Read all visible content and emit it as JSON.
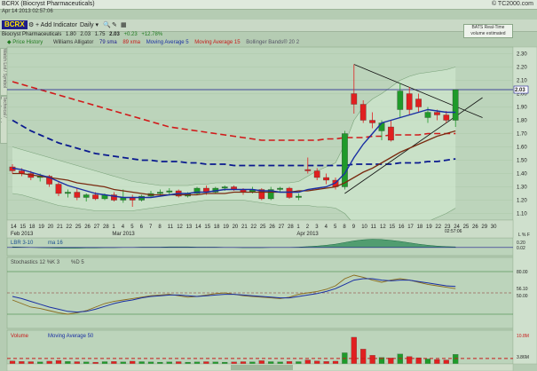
{
  "window": {
    "title": "BCRX (Biocryst Pharmaceuticals)",
    "date": "Apr 14 2013 02:57:06",
    "brand": "© TC2000.com"
  },
  "toolbar": {
    "symbol": "BCRX",
    "add_indicator": "Add Indicator",
    "timeframe": "Daily",
    "bats_label": "BATS Real-Time",
    "bats_sub": "volume estimated"
  },
  "quote": {
    "name": "Biocryst Pharmaceuticals",
    "open": "1.80",
    "high": "2.03",
    "low": "1.75",
    "close": "2.03",
    "change": "+0.23",
    "pct": "+12.78%"
  },
  "legend": [
    "Price History",
    "Williams Alligator",
    "79 sma",
    "89 xma",
    "Moving Average 5",
    "Moving Average 15",
    "Bollinger Bands® 20 2"
  ],
  "side_tabs": [
    "Watch List / Symbol",
    "Technical / Fundamental"
  ],
  "colors": {
    "up": "#1f9a2a",
    "down": "#e02020",
    "ma5": "#1a2fa3",
    "ma15": "#7a2a10",
    "sma79": "#d11a1a",
    "xma89": "#0a1a8f",
    "band": "#7aa37a",
    "lbr": "#2e8b57"
  },
  "chart_data": [
    {
      "type": "candlestick",
      "ylim": [
        1.05,
        2.35
      ],
      "y_ticks": [
        "2.30",
        "2.20",
        "2.10",
        "2.00",
        "1.90",
        "1.80",
        "1.70",
        "1.60",
        "1.50",
        "1.40",
        "1.30",
        "1.20",
        "1.10"
      ],
      "last_price_label": "2.03",
      "x_tick_labels": [
        "14",
        "15",
        "18",
        "19",
        "20",
        "21",
        "22",
        "25",
        "26",
        "27",
        "28",
        "1",
        "4",
        "5",
        "6",
        "7",
        "8",
        "11",
        "12",
        "13",
        "14",
        "15",
        "18",
        "19",
        "20",
        "21",
        "22",
        "25",
        "26",
        "27",
        "28",
        "1",
        "2",
        "3",
        "4",
        "5",
        "8",
        "9",
        "10",
        "11",
        "12",
        "15",
        "16",
        "17",
        "18",
        "19",
        "22",
        "23",
        "24",
        "25",
        "26",
        "29",
        "30"
      ],
      "month_labels": [
        {
          "label": "Feb 2013",
          "at": 0
        },
        {
          "label": "Mar 2013",
          "at": 11
        },
        {
          "label": "Apr 2013",
          "at": 31
        }
      ],
      "corner_label": "02:57:06",
      "axis_options": "L % F",
      "ohlc": [
        [
          1.45,
          1.47,
          1.4,
          1.42
        ],
        [
          1.42,
          1.44,
          1.38,
          1.4
        ],
        [
          1.4,
          1.42,
          1.35,
          1.37
        ],
        [
          1.37,
          1.4,
          1.34,
          1.38
        ],
        [
          1.38,
          1.39,
          1.3,
          1.32
        ],
        [
          1.32,
          1.34,
          1.23,
          1.25
        ],
        [
          1.25,
          1.28,
          1.22,
          1.26
        ],
        [
          1.26,
          1.29,
          1.2,
          1.22
        ],
        [
          1.22,
          1.25,
          1.19,
          1.24
        ],
        [
          1.24,
          1.26,
          1.2,
          1.21
        ],
        [
          1.21,
          1.25,
          1.2,
          1.24
        ],
        [
          1.24,
          1.26,
          1.19,
          1.2
        ],
        [
          1.2,
          1.28,
          1.18,
          1.22
        ],
        [
          1.22,
          1.24,
          1.15,
          1.2
        ],
        [
          1.2,
          1.24,
          1.19,
          1.23
        ],
        [
          1.23,
          1.27,
          1.22,
          1.25
        ],
        [
          1.25,
          1.28,
          1.23,
          1.26
        ],
        [
          1.26,
          1.29,
          1.24,
          1.27
        ],
        [
          1.27,
          1.28,
          1.22,
          1.23
        ],
        [
          1.23,
          1.26,
          1.22,
          1.25
        ],
        [
          1.25,
          1.3,
          1.24,
          1.29
        ],
        [
          1.29,
          1.31,
          1.24,
          1.26
        ],
        [
          1.26,
          1.3,
          1.25,
          1.29
        ],
        [
          1.29,
          1.31,
          1.27,
          1.3
        ],
        [
          1.3,
          1.31,
          1.27,
          1.28
        ],
        [
          1.28,
          1.29,
          1.24,
          1.26
        ],
        [
          1.26,
          1.3,
          1.25,
          1.28
        ],
        [
          1.28,
          1.29,
          1.2,
          1.21
        ],
        [
          1.21,
          1.3,
          1.2,
          1.28
        ],
        [
          1.28,
          1.3,
          1.26,
          1.29
        ],
        [
          1.29,
          1.3,
          1.21,
          1.22
        ],
        [
          1.22,
          1.25,
          1.2,
          1.23
        ],
        [
          1.43,
          1.52,
          1.4,
          1.42
        ],
        [
          1.42,
          1.44,
          1.35,
          1.37
        ],
        [
          1.37,
          1.4,
          1.32,
          1.35
        ],
        [
          1.35,
          1.37,
          1.28,
          1.3
        ],
        [
          1.3,
          1.72,
          1.28,
          1.7
        ],
        [
          2.0,
          2.22,
          1.85,
          1.92
        ],
        [
          1.92,
          1.95,
          1.78,
          1.8
        ],
        [
          1.8,
          1.86,
          1.74,
          1.78
        ],
        [
          1.72,
          1.8,
          1.65,
          1.78
        ],
        [
          1.75,
          1.8,
          1.64,
          1.65
        ],
        [
          1.88,
          2.08,
          1.82,
          2.02
        ],
        [
          2.0,
          2.05,
          1.84,
          1.88
        ],
        [
          1.96,
          2.0,
          1.86,
          1.9
        ],
        [
          1.82,
          1.9,
          1.78,
          1.86
        ],
        [
          1.86,
          1.88,
          1.8,
          1.84
        ],
        [
          1.84,
          1.87,
          1.78,
          1.8
        ],
        [
          1.8,
          2.03,
          1.75,
          2.03
        ]
      ],
      "series": [
        {
          "name": "Moving Average 5",
          "values": [
            1.44,
            1.43,
            1.41,
            1.39,
            1.37,
            1.34,
            1.31,
            1.29,
            1.27,
            1.25,
            1.24,
            1.23,
            1.22,
            1.22,
            1.22,
            1.22,
            1.23,
            1.24,
            1.25,
            1.25,
            1.26,
            1.26,
            1.27,
            1.28,
            1.28,
            1.28,
            1.28,
            1.27,
            1.27,
            1.26,
            1.26,
            1.26,
            1.28,
            1.29,
            1.3,
            1.33,
            1.4,
            1.52,
            1.62,
            1.7,
            1.78,
            1.8,
            1.82,
            1.84,
            1.86,
            1.88,
            1.87,
            1.86,
            1.86
          ]
        },
        {
          "name": "Moving Average 15",
          "values": [
            1.4,
            1.4,
            1.39,
            1.38,
            1.37,
            1.36,
            1.35,
            1.33,
            1.32,
            1.31,
            1.3,
            1.28,
            1.27,
            1.26,
            1.25,
            1.24,
            1.24,
            1.24,
            1.24,
            1.24,
            1.24,
            1.25,
            1.25,
            1.25,
            1.26,
            1.26,
            1.26,
            1.26,
            1.26,
            1.26,
            1.26,
            1.27,
            1.27,
            1.28,
            1.29,
            1.3,
            1.33,
            1.37,
            1.41,
            1.44,
            1.48,
            1.52,
            1.56,
            1.59,
            1.62,
            1.65,
            1.68,
            1.7,
            1.72
          ]
        },
        {
          "name": "79 sma",
          "values": [
            2.09,
            2.07,
            2.05,
            2.03,
            2.01,
            1.99,
            1.97,
            1.95,
            1.93,
            1.91,
            1.89,
            1.87,
            1.85,
            1.83,
            1.81,
            1.79,
            1.77,
            1.75,
            1.74,
            1.73,
            1.72,
            1.71,
            1.7,
            1.69,
            1.68,
            1.67,
            1.66,
            1.65,
            1.65,
            1.65,
            1.65,
            1.65,
            1.65,
            1.65,
            1.66,
            1.66,
            1.67,
            1.67,
            1.67,
            1.68,
            1.68,
            1.69,
            1.69,
            1.69,
            1.69,
            1.7,
            1.7,
            1.7,
            1.7
          ]
        },
        {
          "name": "89 xma",
          "values": [
            1.8,
            1.76,
            1.72,
            1.69,
            1.66,
            1.63,
            1.61,
            1.59,
            1.57,
            1.55,
            1.54,
            1.53,
            1.52,
            1.51,
            1.5,
            1.5,
            1.49,
            1.49,
            1.49,
            1.48,
            1.48,
            1.47,
            1.47,
            1.47,
            1.46,
            1.46,
            1.46,
            1.46,
            1.46,
            1.46,
            1.46,
            1.46,
            1.46,
            1.46,
            1.46,
            1.46,
            1.46,
            1.47,
            1.47,
            1.47,
            1.47,
            1.47,
            1.48,
            1.48,
            1.48,
            1.49,
            1.49,
            1.5,
            1.51
          ]
        },
        {
          "name": "BB upper",
          "values": [
            1.6,
            1.58,
            1.56,
            1.54,
            1.52,
            1.5,
            1.48,
            1.46,
            1.44,
            1.42,
            1.4,
            1.38,
            1.36,
            1.34,
            1.33,
            1.32,
            1.31,
            1.31,
            1.31,
            1.31,
            1.32,
            1.32,
            1.33,
            1.33,
            1.33,
            1.33,
            1.33,
            1.33,
            1.33,
            1.33,
            1.33,
            1.34,
            1.38,
            1.42,
            1.45,
            1.48,
            1.62,
            1.8,
            1.9,
            1.96,
            2.0,
            2.05,
            2.1,
            2.13,
            2.15,
            2.16,
            2.17,
            2.18,
            2.2
          ]
        },
        {
          "name": "BB lower",
          "values": [
            1.25,
            1.24,
            1.22,
            1.2,
            1.18,
            1.16,
            1.15,
            1.14,
            1.13,
            1.12,
            1.12,
            1.12,
            1.12,
            1.12,
            1.13,
            1.14,
            1.15,
            1.16,
            1.17,
            1.18,
            1.19,
            1.2,
            1.2,
            1.2,
            1.2,
            1.2,
            1.19,
            1.18,
            1.17,
            1.16,
            1.16,
            1.16,
            1.16,
            1.15,
            1.15,
            1.14,
            1.1,
            1.02,
            0.98,
            0.96,
            0.96,
            0.97,
            0.98,
            1.0,
            1.02,
            1.04,
            1.07,
            1.1,
            1.14
          ]
        }
      ]
    },
    {
      "type": "area",
      "title": "LBR 3-10",
      "subtitle": "ma 16",
      "ylim": [
        -0.3,
        0.35
      ],
      "y_ticks": [
        "0.20",
        "0.02"
      ],
      "values": [
        0.02,
        0.01,
        0.0,
        -0.01,
        -0.02,
        -0.03,
        -0.03,
        -0.03,
        -0.02,
        -0.02,
        -0.01,
        -0.01,
        0.0,
        0.0,
        0.01,
        0.01,
        0.01,
        0.02,
        0.02,
        0.02,
        0.01,
        0.01,
        0.01,
        0.0,
        0.0,
        -0.01,
        -0.01,
        -0.01,
        0.0,
        0.0,
        0.0,
        0.01,
        0.03,
        0.05,
        0.08,
        0.12,
        0.18,
        0.24,
        0.28,
        0.3,
        0.29,
        0.26,
        0.22,
        0.17,
        0.12,
        0.08,
        0.05,
        0.03,
        0.02
      ]
    },
    {
      "type": "line",
      "title": "Stochastics 12 %K 3",
      "subtitle": "%D 5",
      "ylim": [
        0,
        100
      ],
      "y_ticks": [
        "80.00",
        "56.10",
        "50.00"
      ],
      "series": [
        {
          "name": "%K",
          "values": [
            40,
            35,
            30,
            28,
            25,
            22,
            20,
            22,
            25,
            30,
            35,
            38,
            40,
            42,
            44,
            46,
            47,
            48,
            46,
            44,
            45,
            47,
            49,
            50,
            48,
            46,
            45,
            44,
            43,
            42,
            44,
            48,
            50,
            52,
            55,
            60,
            70,
            75,
            72,
            68,
            65,
            68,
            70,
            68,
            65,
            62,
            60,
            58,
            56
          ]
        },
        {
          "name": "%D",
          "values": [
            45,
            42,
            38,
            34,
            30,
            27,
            24,
            23,
            24,
            27,
            31,
            35,
            38,
            40,
            43,
            45,
            46,
            47,
            47,
            46,
            45,
            46,
            47,
            48,
            48,
            47,
            46,
            45,
            44,
            43,
            43,
            45,
            47,
            49,
            52,
            56,
            62,
            68,
            70,
            70,
            68,
            67,
            68,
            68,
            66,
            64,
            62,
            60,
            59
          ]
        }
      ]
    },
    {
      "type": "bar",
      "title": "Volume",
      "subtitle": "Moving Average 50",
      "y_ticks": [
        "10.8M",
        "3.86M"
      ],
      "values": [
        1.2,
        1.0,
        0.9,
        0.8,
        1.1,
        1.4,
        1.0,
        0.9,
        0.8,
        0.7,
        0.9,
        1.0,
        0.8,
        1.1,
        0.9,
        0.8,
        0.7,
        0.8,
        0.9,
        0.7,
        0.8,
        0.9,
        0.8,
        0.7,
        0.8,
        0.9,
        0.8,
        1.3,
        0.9,
        0.8,
        1.0,
        0.9,
        1.6,
        1.2,
        1.0,
        1.1,
        4.5,
        10.8,
        6.0,
        3.5,
        2.6,
        2.4,
        4.0,
        3.0,
        2.5,
        2.0,
        1.8,
        1.6,
        3.86
      ],
      "ma": 2.2
    }
  ]
}
